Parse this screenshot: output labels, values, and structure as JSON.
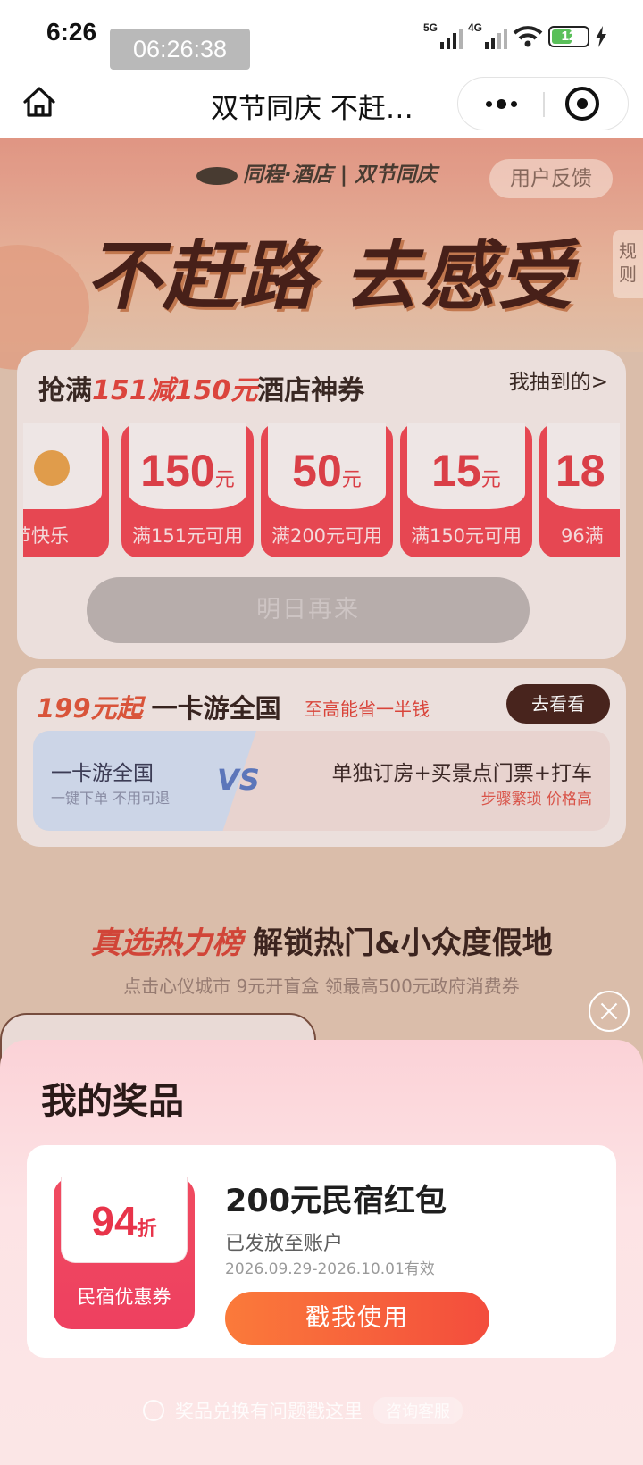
{
  "status_bar": {
    "time": "6:26",
    "overlay_time": "06:26:38",
    "signal1": "5G",
    "signal2": "4G",
    "battery": "12"
  },
  "nav": {
    "title": "双节同庆 不赶…"
  },
  "header": {
    "brand": "同程·酒店 | 双节同庆",
    "feedback": "用户反馈",
    "rules": "规则",
    "slogan": "不赶路 去感受"
  },
  "lottery": {
    "title_prefix": "抢满",
    "title_highlight": "151减150元",
    "title_suffix": "酒店神券",
    "mine": "我抽到的>",
    "coupons": [
      {
        "amount": "",
        "unit": "",
        "cond": "节快乐"
      },
      {
        "amount": "150",
        "unit": "元",
        "cond": "满151元可用"
      },
      {
        "amount": "50",
        "unit": "元",
        "cond": "满200元可用"
      },
      {
        "amount": "15",
        "unit": "元",
        "cond": "满150元可用"
      },
      {
        "amount": "18",
        "unit": "",
        "cond": "96满"
      }
    ],
    "button": "明日再来"
  },
  "card_pass": {
    "price": "199元起",
    "title": "一卡游全国",
    "sub": "至高能省一半钱",
    "go": "去看看",
    "left_title": "一卡游全国",
    "left_sub": "一键下单 不用可退",
    "vs": "VS",
    "right_title": "单独订房+买景点门票+打车",
    "right_sub": "步骤繁琐 价格高"
  },
  "ranking": {
    "title_hl": "真选热力榜",
    "title_rest": " 解锁热门&小众度假地",
    "sub": "点击心仪城市 9元开盲盒 领最高500元政府消费券"
  },
  "sheet": {
    "title": "我的奖品",
    "prize": {
      "discount": "94",
      "discount_unit": "折",
      "ticket_label": "民宿优惠券",
      "name": "200元民宿红包",
      "status": "已发放至账户",
      "validity": "2026.09.29-2026.10.01有效",
      "use_button": "戳我使用"
    },
    "help_text": "奖品兑换有问题戳这里",
    "contact": "咨询客服"
  }
}
